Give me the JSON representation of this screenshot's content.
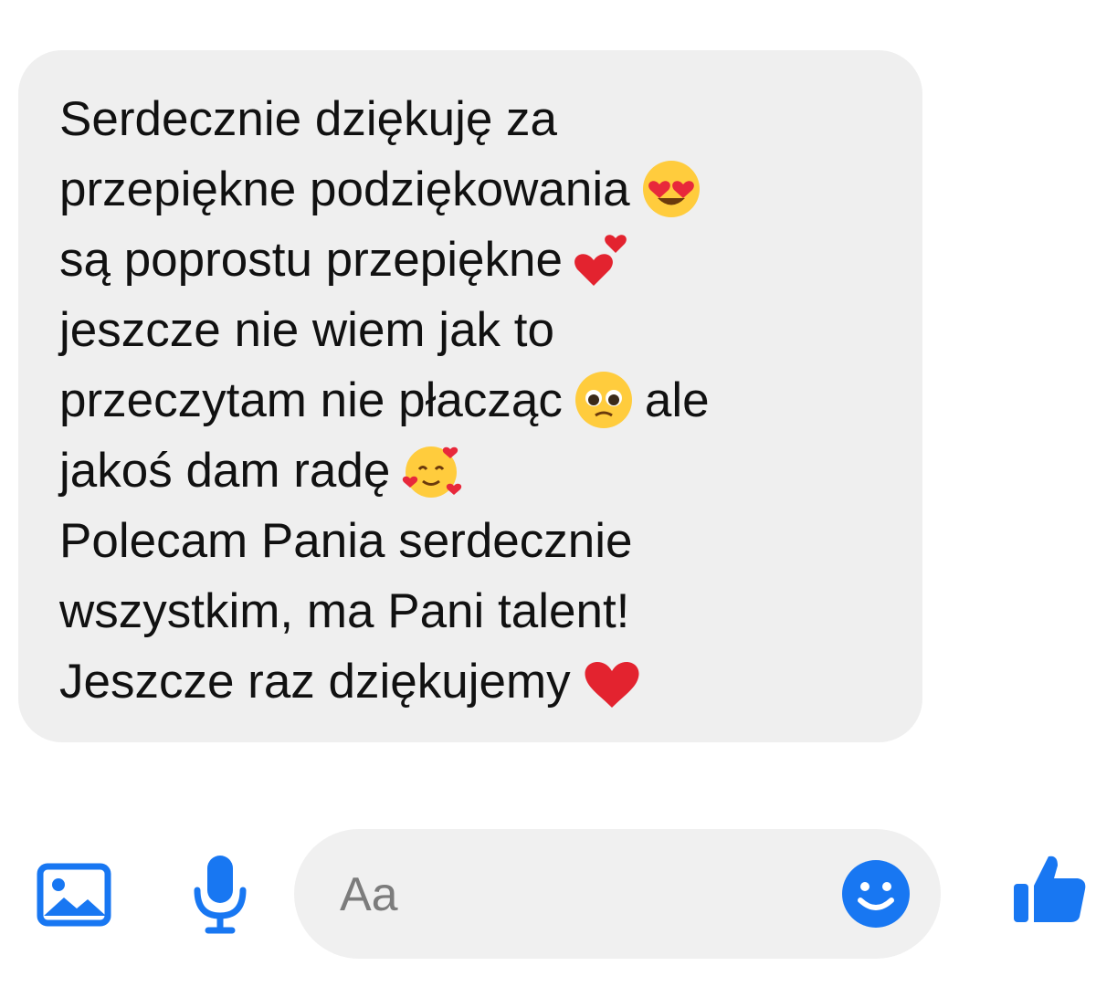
{
  "message": {
    "lines": [
      {
        "text": "Serdecznie dziękuję za",
        "emoji": null
      },
      {
        "text": "przepiękne podziękowania",
        "emoji": "heart-eyes-emoji"
      },
      {
        "text": "są poprostu przepiękne",
        "emoji": "two-hearts-emoji"
      },
      {
        "text": "jeszcze nie wiem jak to",
        "emoji": null
      },
      {
        "text": "przeczytam nie płacząc",
        "emoji": "pleading-face-emoji",
        "after": "ale"
      },
      {
        "text": "jakoś dam radę",
        "emoji": "smiling-face-with-hearts-emoji"
      },
      {
        "text": "Polecam Pania serdecznie",
        "emoji": null
      },
      {
        "text": "wszystkim, ma Pani talent!",
        "emoji": null
      },
      {
        "text": "Jeszcze raz dziękujemy",
        "emoji": "red-heart-emoji"
      }
    ]
  },
  "composer": {
    "placeholder": "Aa",
    "icons": [
      "image-icon",
      "microphone-icon",
      "emoji-icon",
      "thumbs-up-icon"
    ]
  },
  "colors": {
    "bubble": "#efefef",
    "accent": "#1877f2",
    "text": "#111111"
  }
}
